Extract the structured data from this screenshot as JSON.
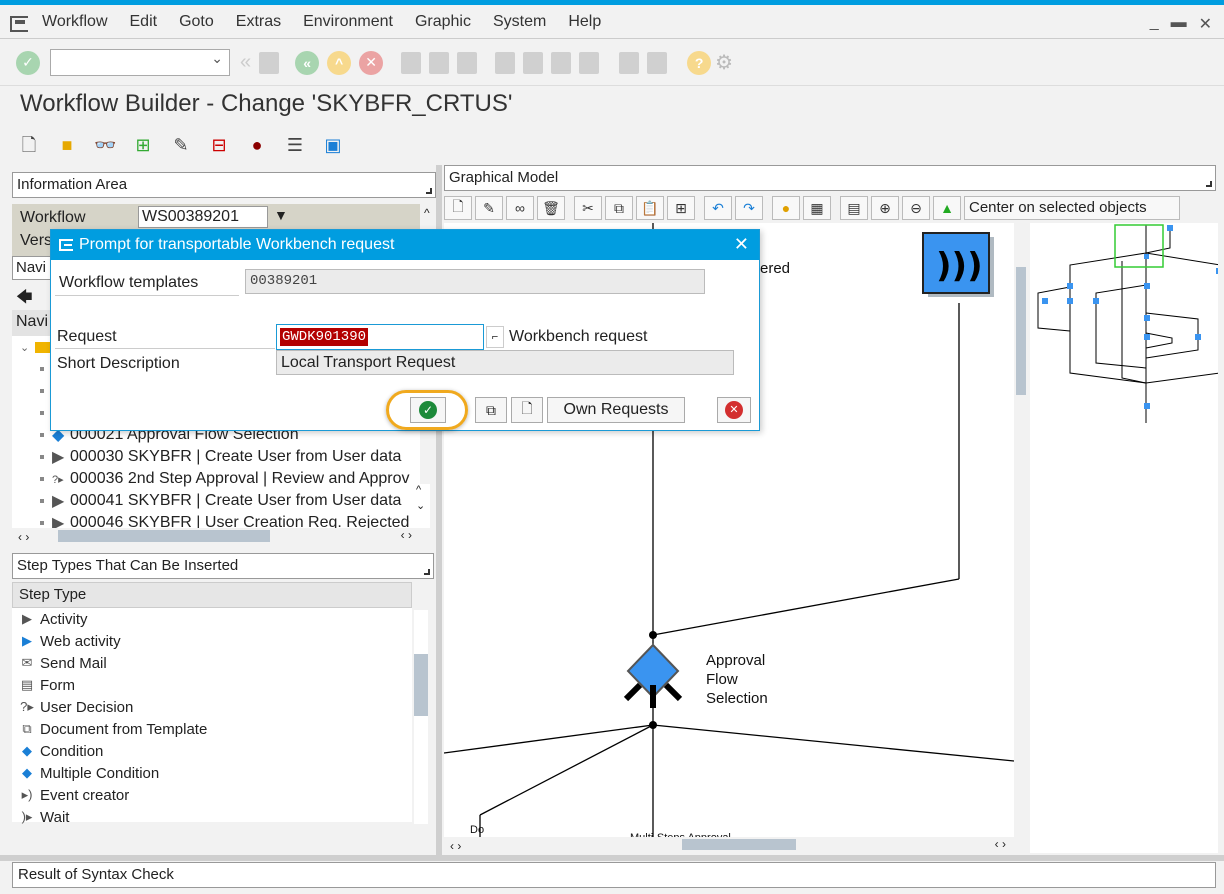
{
  "window": {
    "title": "Workflow Builder - Change 'SKYBFR_CRTUS'"
  },
  "menu": [
    "Workflow",
    "Edit",
    "Goto",
    "Extras",
    "Environment",
    "Graphic",
    "System",
    "Help"
  ],
  "window_controls": [
    "minimize",
    "maximize",
    "close"
  ],
  "command_field": {
    "value": ""
  },
  "information_area": {
    "header": "Information Area",
    "workflow_label": "Workflow",
    "workflow_value": "WS00389201",
    "version_label": "Vers",
    "nav_label": "Navi"
  },
  "navigation": {
    "header": "Navi",
    "items": [
      {
        "icon": "condition-icon",
        "label": "000021 Approval Flow Selection"
      },
      {
        "icon": "activity-icon",
        "label": "000030 SKYBFR | Create User from User data"
      },
      {
        "icon": "user-decision-icon",
        "label": "000036 2nd Step Approval | Review and Approv"
      },
      {
        "icon": "activity-icon",
        "label": "000041 SKYBFR | Create User from User data"
      },
      {
        "icon": "activity-icon",
        "label": "000046 SKYBFR | User Creation Req. Rejected"
      }
    ]
  },
  "step_types": {
    "header": "Step Types That Can Be Inserted",
    "column": "Step Type",
    "items": [
      {
        "icon": "activity-icon",
        "glyph": "▶",
        "label": "Activity"
      },
      {
        "icon": "web-activity-icon",
        "glyph": "▶",
        "label": "Web activity"
      },
      {
        "icon": "send-mail-icon",
        "glyph": "✉",
        "label": "Send Mail"
      },
      {
        "icon": "form-icon",
        "glyph": "▤",
        "label": "Form"
      },
      {
        "icon": "user-decision-icon",
        "glyph": "?▸",
        "label": "User Decision"
      },
      {
        "icon": "document-template-icon",
        "glyph": "⧉",
        "label": "Document from Template"
      },
      {
        "icon": "condition-icon",
        "glyph": "◆",
        "label": "Condition"
      },
      {
        "icon": "multiple-condition-icon",
        "glyph": "◆",
        "label": "Multiple Condition"
      },
      {
        "icon": "event-creator-icon",
        "glyph": "▸)",
        "label": "Event creator"
      },
      {
        "icon": "wait-icon",
        "glyph": ")▸",
        "label": "Wait"
      }
    ]
  },
  "graphical_model": {
    "header": "Graphical Model",
    "center_label": "Center on selected objects",
    "nodes": [
      {
        "label": "Approval Flow Selection",
        "lines": [
          "Approval",
          "Flow",
          "Selection"
        ]
      }
    ],
    "partial_labels": [
      "ered",
      "Do",
      "Multi-Steps Approval"
    ]
  },
  "result": {
    "header": "Result of Syntax Check"
  },
  "dialog": {
    "title": "Prompt for transportable Workbench request",
    "workflow_templates_label": "Workflow templates",
    "workflow_templates_value": "00389201",
    "request_label": "Request",
    "request_value": "GWDK901390",
    "request_type": "Workbench request",
    "short_desc_label": "Short Description",
    "short_desc_value": "Local Transport Request",
    "own_requests_label": "Own Requests"
  }
}
